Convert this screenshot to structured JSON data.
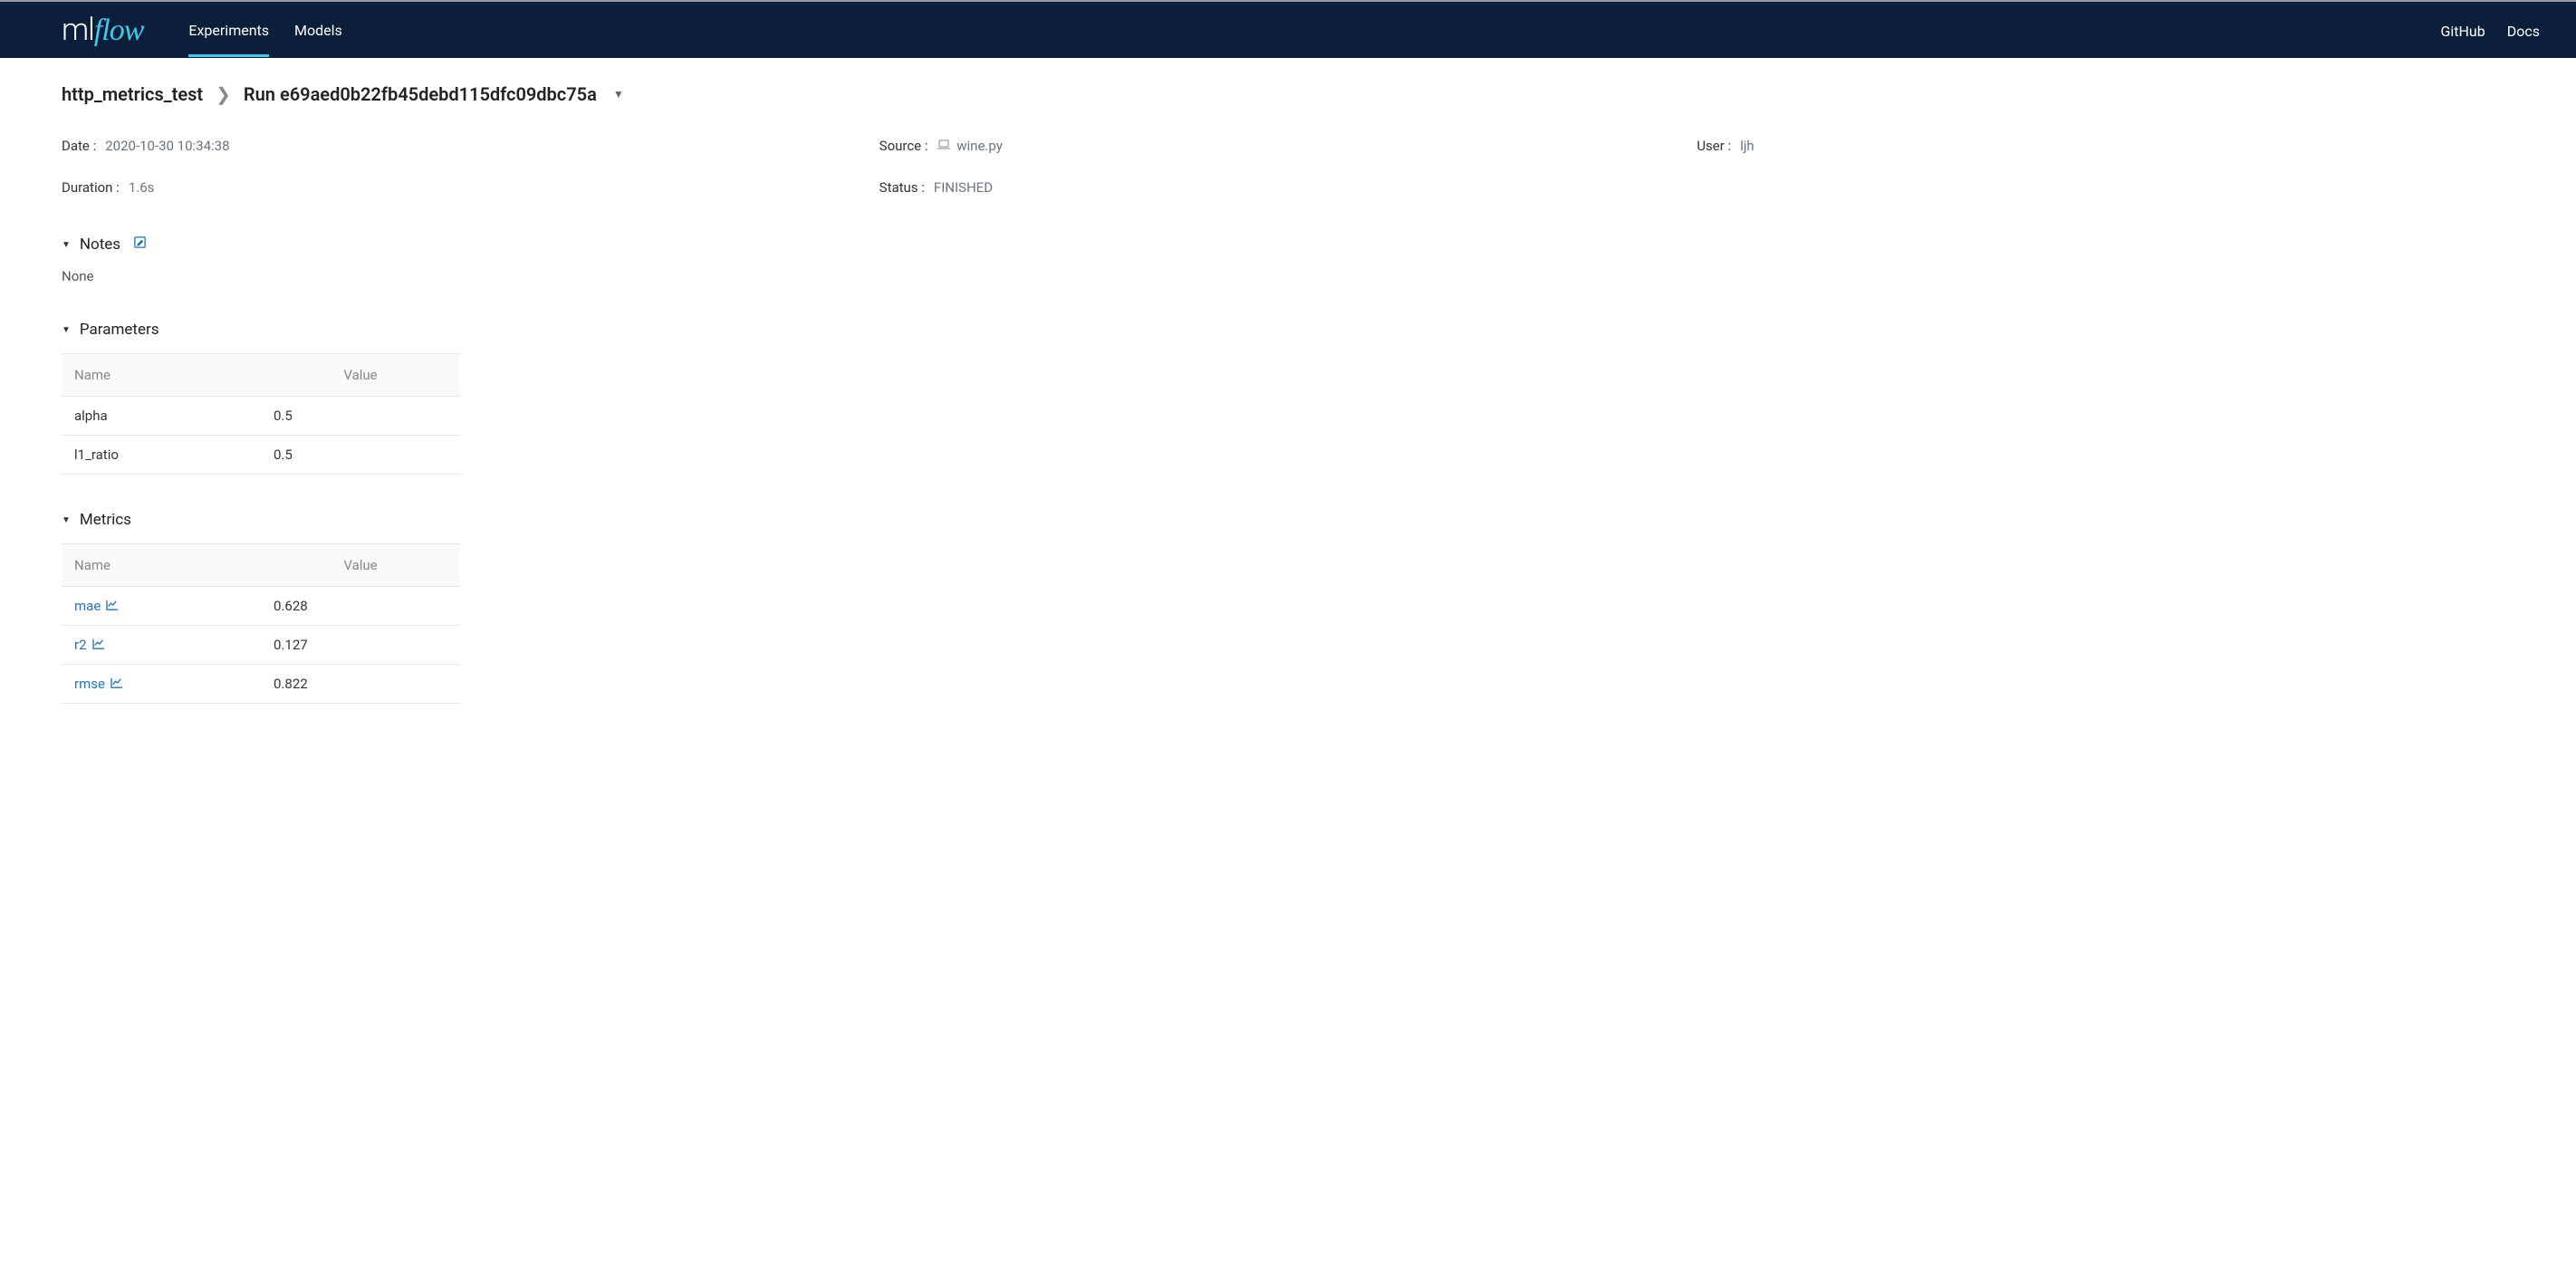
{
  "header": {
    "logo_ml": "ml",
    "logo_flow": "flow",
    "nav": {
      "experiments": "Experiments",
      "models": "Models",
      "github": "GitHub",
      "docs": "Docs"
    }
  },
  "breadcrumb": {
    "experiment": "http_metrics_test",
    "run_prefix": "Run",
    "run_id": "e69aed0b22fb45debd115dfc09dbc75a"
  },
  "meta": {
    "date_label": "Date :",
    "date_value": "2020-10-30 10:34:38",
    "source_label": "Source :",
    "source_value": "wine.py",
    "user_label": "User :",
    "user_value": "ljh",
    "duration_label": "Duration :",
    "duration_value": "1.6s",
    "status_label": "Status :",
    "status_value": "FINISHED"
  },
  "sections": {
    "notes": {
      "title": "Notes",
      "content": "None"
    },
    "parameters": {
      "title": "Parameters",
      "col_name": "Name",
      "col_value": "Value",
      "rows": [
        {
          "name": "alpha",
          "value": "0.5"
        },
        {
          "name": "l1_ratio",
          "value": "0.5"
        }
      ]
    },
    "metrics": {
      "title": "Metrics",
      "col_name": "Name",
      "col_value": "Value",
      "rows": [
        {
          "name": "mae",
          "value": "0.628"
        },
        {
          "name": "r2",
          "value": "0.127"
        },
        {
          "name": "rmse",
          "value": "0.822"
        }
      ]
    }
  }
}
